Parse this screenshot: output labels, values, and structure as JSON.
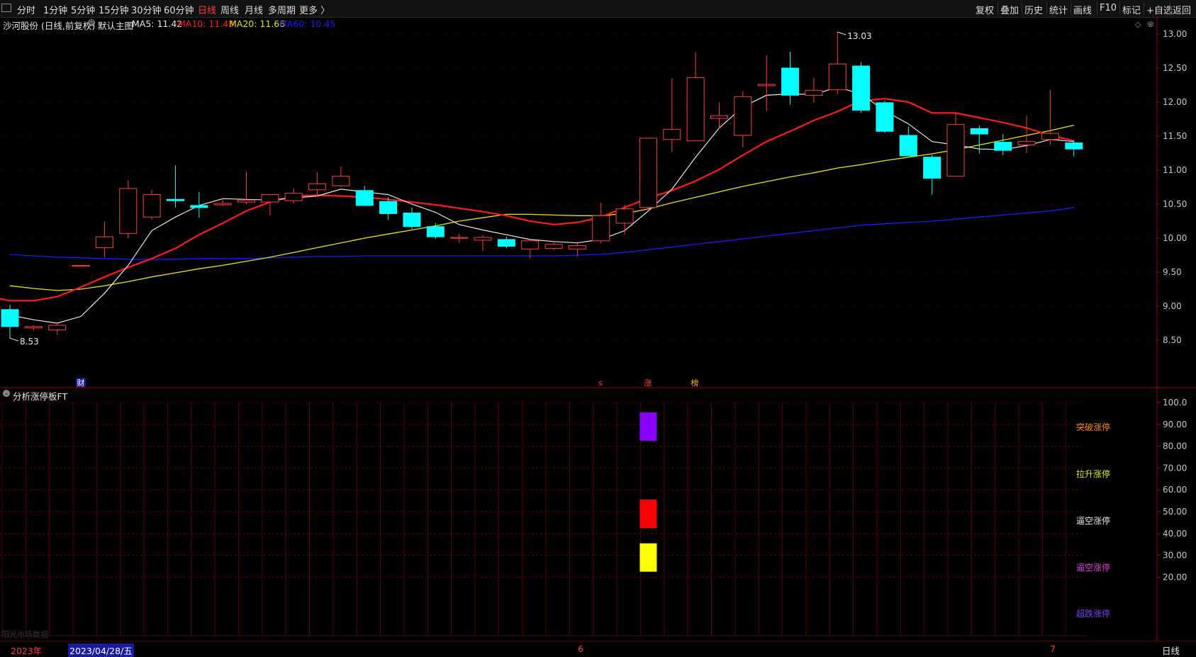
{
  "toolbar": {
    "left": [
      {
        "label": "分时"
      },
      {
        "label": "1分钟"
      },
      {
        "label": "5分钟"
      },
      {
        "label": "15分钟"
      },
      {
        "label": "30分钟"
      },
      {
        "label": "60分钟"
      },
      {
        "label": "日线",
        "active": true
      },
      {
        "label": "周线"
      },
      {
        "label": "月线"
      },
      {
        "label": "多周期"
      },
      {
        "label": "更多 〉"
      }
    ],
    "right": [
      {
        "label": "复权"
      },
      {
        "label": "叠加"
      },
      {
        "label": "历史"
      },
      {
        "label": "统计"
      },
      {
        "label": "画线"
      },
      {
        "label": "F10"
      },
      {
        "label": "标记"
      },
      {
        "label": "+自选"
      },
      {
        "label": "返回"
      }
    ]
  },
  "info": {
    "stock": "沙河股份 (日线,前复权)",
    "main_chart": "默认主图",
    "ma5": "MA5: 11.42",
    "ma10": "MA10: 11.43",
    "ma20": "MA20: 11.66",
    "ma60": "MA60: 10.45"
  },
  "lower_panel": {
    "title": "分析涨停板FT",
    "labels": [
      {
        "text": "突破涨停",
        "color": "#ff8c1a"
      },
      {
        "text": "拉升涨停",
        "color": "#e6e600"
      },
      {
        "text": "逼空涨停",
        "color": "#e8e8e8"
      },
      {
        "text": "逼空涨停",
        "color": "#e040e0"
      },
      {
        "text": "超跌涨停",
        "color": "#7a3cff"
      }
    ],
    "watermark": "阳光市场数据"
  },
  "markers": {
    "finance": "财",
    "s": "s",
    "limit_up": "涨",
    "ranking": "榜"
  },
  "dates": {
    "year": "2023年",
    "cursor": "2023/04/28/五",
    "june": "6",
    "july": "7",
    "period": "日线"
  },
  "colors": {
    "up": "#ff3c3c",
    "down": "#00ffff",
    "ma5": "#e8e8e8",
    "ma10": "#ff1a1a",
    "ma20": "#e6e600",
    "ma60": "#1a1aff",
    "grid": "#5a0000"
  },
  "chart_data": {
    "type": "candlestick",
    "price_axis": {
      "ylim": [
        8.4,
        13.1
      ],
      "ticks": [
        "13.00",
        "12.50",
        "12.00",
        "11.50",
        "11.00",
        "10.50",
        "10.00",
        "9.50",
        "9.00",
        "8.50"
      ]
    },
    "annotations": {
      "max": "13.03",
      "min": "8.53"
    },
    "candles": [
      {
        "o": 8.95,
        "h": 9.02,
        "l": 8.53,
        "c": 8.7
      },
      {
        "o": 8.68,
        "h": 8.72,
        "l": 8.64,
        "c": 8.7
      },
      {
        "o": 8.65,
        "h": 8.75,
        "l": 8.58,
        "c": 8.72
      },
      {
        "o": 9.6,
        "h": 9.6,
        "l": 9.6,
        "c": 9.6
      },
      {
        "o": 9.86,
        "h": 10.24,
        "l": 9.72,
        "c": 10.02
      },
      {
        "o": 10.07,
        "h": 10.85,
        "l": 10.0,
        "c": 10.73
      },
      {
        "o": 10.31,
        "h": 10.71,
        "l": 10.27,
        "c": 10.64
      },
      {
        "o": 10.57,
        "h": 11.07,
        "l": 10.45,
        "c": 10.55
      },
      {
        "o": 10.48,
        "h": 10.68,
        "l": 10.3,
        "c": 10.45
      },
      {
        "o": 10.49,
        "h": 10.58,
        "l": 10.47,
        "c": 10.51
      },
      {
        "o": 10.53,
        "h": 10.97,
        "l": 10.5,
        "c": 10.56
      },
      {
        "o": 10.53,
        "h": 10.65,
        "l": 10.33,
        "c": 10.64
      },
      {
        "o": 10.55,
        "h": 10.73,
        "l": 10.51,
        "c": 10.66
      },
      {
        "o": 10.71,
        "h": 10.97,
        "l": 10.6,
        "c": 10.8
      },
      {
        "o": 10.77,
        "h": 11.05,
        "l": 10.75,
        "c": 10.91
      },
      {
        "o": 10.7,
        "h": 10.77,
        "l": 10.47,
        "c": 10.48
      },
      {
        "o": 10.54,
        "h": 10.6,
        "l": 10.27,
        "c": 10.36
      },
      {
        "o": 10.37,
        "h": 10.45,
        "l": 10.13,
        "c": 10.17
      },
      {
        "o": 10.17,
        "h": 10.22,
        "l": 9.99,
        "c": 10.02
      },
      {
        "o": 10.01,
        "h": 10.07,
        "l": 9.93,
        "c": 10.01
      },
      {
        "o": 9.97,
        "h": 10.05,
        "l": 9.81,
        "c": 10.01
      },
      {
        "o": 9.98,
        "h": 10.02,
        "l": 9.85,
        "c": 9.88
      },
      {
        "o": 9.84,
        "h": 9.98,
        "l": 9.7,
        "c": 9.96
      },
      {
        "o": 9.85,
        "h": 9.94,
        "l": 9.82,
        "c": 9.91
      },
      {
        "o": 9.84,
        "h": 9.95,
        "l": 9.73,
        "c": 9.89
      },
      {
        "o": 9.96,
        "h": 10.52,
        "l": 9.92,
        "c": 10.33
      },
      {
        "o": 10.22,
        "h": 10.49,
        "l": 10.05,
        "c": 10.43
      },
      {
        "o": 10.45,
        "h": 11.47,
        "l": 10.42,
        "c": 11.47
      },
      {
        "o": 11.45,
        "h": 12.35,
        "l": 11.27,
        "c": 11.6
      },
      {
        "o": 11.43,
        "h": 12.73,
        "l": 11.43,
        "c": 12.36
      },
      {
        "o": 11.76,
        "h": 11.99,
        "l": 11.61,
        "c": 11.8
      },
      {
        "o": 11.51,
        "h": 12.16,
        "l": 11.33,
        "c": 12.08
      },
      {
        "o": 12.24,
        "h": 12.69,
        "l": 11.87,
        "c": 12.26
      },
      {
        "o": 12.5,
        "h": 12.74,
        "l": 11.96,
        "c": 12.1
      },
      {
        "o": 12.1,
        "h": 12.36,
        "l": 11.99,
        "c": 12.17
      },
      {
        "o": 12.18,
        "h": 13.03,
        "l": 12.11,
        "c": 12.56
      },
      {
        "o": 12.53,
        "h": 12.59,
        "l": 11.84,
        "c": 11.88
      },
      {
        "o": 11.99,
        "h": 12.02,
        "l": 11.55,
        "c": 11.57
      },
      {
        "o": 11.51,
        "h": 11.64,
        "l": 11.21,
        "c": 11.21
      },
      {
        "o": 11.19,
        "h": 11.23,
        "l": 10.64,
        "c": 10.88
      },
      {
        "o": 10.91,
        "h": 11.84,
        "l": 10.91,
        "c": 11.67
      },
      {
        "o": 11.61,
        "h": 11.66,
        "l": 11.24,
        "c": 11.53
      },
      {
        "o": 11.41,
        "h": 11.53,
        "l": 11.22,
        "c": 11.29
      },
      {
        "o": 11.37,
        "h": 11.8,
        "l": 11.25,
        "c": 11.42
      },
      {
        "o": 11.45,
        "h": 12.18,
        "l": 11.37,
        "c": 11.54
      },
      {
        "o": 11.4,
        "h": 11.44,
        "l": 11.2,
        "c": 11.31
      }
    ],
    "ma5": [
      8.87,
      8.8,
      8.75,
      8.85,
      9.19,
      9.6,
      10.11,
      10.31,
      10.48,
      10.58,
      10.57,
      10.56,
      10.59,
      10.62,
      10.72,
      10.68,
      10.64,
      10.5,
      10.38,
      10.2,
      10.12,
      10.05,
      9.98,
      9.95,
      9.93,
      9.98,
      10.11,
      10.4,
      10.72,
      11.19,
      11.62,
      11.93,
      12.1,
      12.12,
      12.11,
      12.22,
      12.12,
      11.87,
      11.68,
      11.42,
      11.37,
      11.31,
      11.3,
      11.36,
      11.45,
      11.42
    ],
    "ma10": [
      9.26,
      9.15,
      9.08,
      9.08,
      9.14,
      9.28,
      9.43,
      9.57,
      9.7,
      9.85,
      10.05,
      10.22,
      10.4,
      10.53,
      10.62,
      10.63,
      10.62,
      10.6,
      10.57,
      10.53,
      10.49,
      10.44,
      10.39,
      10.33,
      10.25,
      10.2,
      10.23,
      10.31,
      10.45,
      10.59,
      10.7,
      10.84,
      11.01,
      11.22,
      11.42,
      11.57,
      11.73,
      11.86,
      12.02,
      12.05,
      12.0,
      11.84,
      11.84,
      11.77,
      11.7,
      11.62,
      11.51,
      11.43
    ],
    "ma20": [
      9.3,
      9.26,
      9.23,
      9.25,
      9.3,
      9.36,
      9.43,
      9.49,
      9.55,
      9.6,
      9.66,
      9.72,
      9.79,
      9.86,
      9.93,
      10.0,
      10.06,
      10.12,
      10.18,
      10.25,
      10.3,
      10.35,
      10.35,
      10.34,
      10.33,
      10.33,
      10.36,
      10.43,
      10.52,
      10.6,
      10.68,
      10.76,
      10.83,
      10.9,
      10.96,
      11.03,
      11.08,
      11.14,
      11.19,
      11.24,
      11.3,
      11.37,
      11.44,
      11.51,
      11.58,
      11.66
    ],
    "ma60": [
      9.76,
      9.74,
      9.72,
      9.71,
      9.7,
      9.69,
      9.69,
      9.69,
      9.7,
      9.7,
      9.7,
      9.71,
      9.72,
      9.73,
      9.73,
      9.74,
      9.74,
      9.74,
      9.74,
      9.74,
      9.74,
      9.74,
      9.74,
      9.74,
      9.75,
      9.76,
      9.79,
      9.83,
      9.87,
      9.91,
      9.95,
      9.99,
      10.03,
      10.07,
      10.11,
      10.15,
      10.19,
      10.21,
      10.23,
      10.25,
      10.28,
      10.31,
      10.34,
      10.37,
      10.4,
      10.45
    ],
    "limit_up_bars": [
      {
        "index": 27,
        "series": "突破涨停",
        "value": 89,
        "color": "#8a00ff"
      },
      {
        "index": 27,
        "series": "逼空涨停",
        "value": 49,
        "color": "#ff0000"
      },
      {
        "index": 27,
        "series": "逼空涨停",
        "value": 29,
        "color": "#ffff00"
      }
    ],
    "lower_axis": {
      "ylim": [
        0,
        100
      ],
      "ticks": [
        "100.0",
        "90.00",
        "80.00",
        "70.00",
        "60.00",
        "50.00",
        "40.00",
        "30.00",
        "20.00"
      ]
    }
  }
}
